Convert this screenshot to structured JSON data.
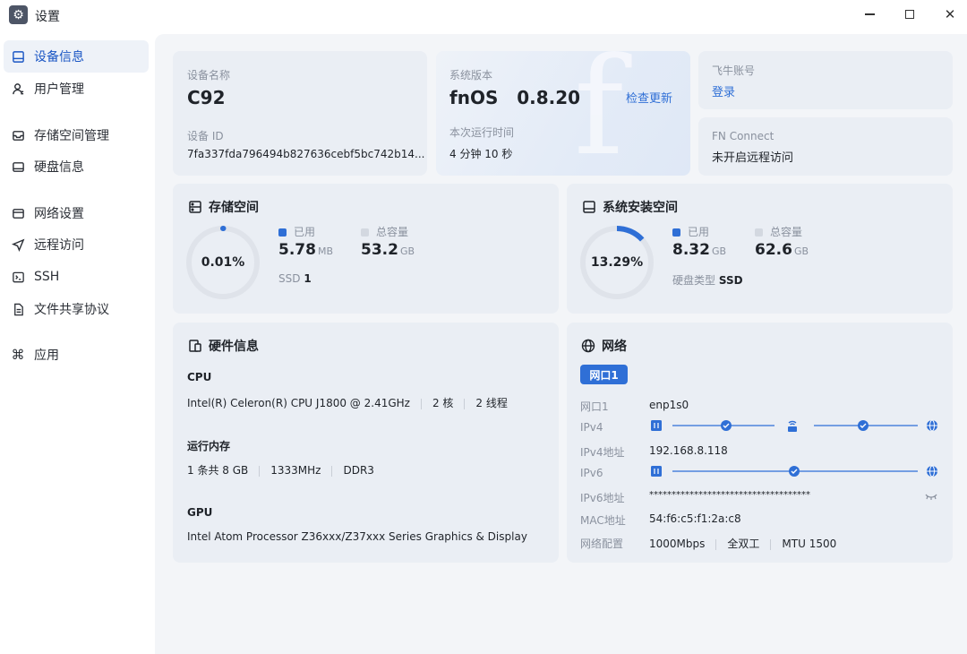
{
  "window": {
    "title": "设置"
  },
  "sidebar": {
    "items": [
      {
        "label": "设备信息",
        "icon": "device-icon"
      },
      {
        "label": "用户管理",
        "icon": "user-icon"
      },
      {
        "label": "存储空间管理",
        "icon": "storage-icon"
      },
      {
        "label": "硬盘信息",
        "icon": "disk-icon"
      },
      {
        "label": "网络设置",
        "icon": "network-icon"
      },
      {
        "label": "远程访问",
        "icon": "send-icon"
      },
      {
        "label": "SSH",
        "icon": "terminal-icon"
      },
      {
        "label": "文件共享协议",
        "icon": "file-icon"
      },
      {
        "label": "应用",
        "icon": "command-icon"
      }
    ]
  },
  "device": {
    "name_label": "设备名称",
    "name": "C92",
    "id_label": "设备 ID",
    "id": "7fa337fda796494b827636cebf5bc742b14..."
  },
  "version": {
    "label": "系统版本",
    "value": "fnOS   0.8.20",
    "check_update": "检查更新",
    "uptime_label": "本次运行时间",
    "uptime": "4 分钟 10 秒"
  },
  "account": {
    "label": "飞牛账号",
    "login": "登录"
  },
  "fnconnect": {
    "label": "FN Connect",
    "status": "未开启远程访问"
  },
  "storage": {
    "title": "存储空间",
    "percent_text": "0.01%",
    "percent": 0.0001,
    "used_label": "已用",
    "used_value": "5.78",
    "used_unit": "MB",
    "total_label": "总容量",
    "total_value": "53.2",
    "total_unit": "GB",
    "disk_prefix": "SSD",
    "disk_count": "1"
  },
  "sysinstall": {
    "title": "系统安装空间",
    "percent_text": "13.29%",
    "percent": 0.1329,
    "used_label": "已用",
    "used_value": "8.32",
    "used_unit": "GB",
    "total_label": "总容量",
    "total_value": "62.6",
    "total_unit": "GB",
    "disk_type_label": "硬盘类型",
    "disk_type": "SSD"
  },
  "hardware": {
    "title": "硬件信息",
    "cpu_label": "CPU",
    "cpu_model": "Intel(R) Celeron(R) CPU J1800 @ 2.41GHz",
    "cpu_cores": "2 核",
    "cpu_threads": "2 线程",
    "mem_label": "运行内存",
    "mem_slots": "1 条共 8 GB",
    "mem_speed": "1333MHz",
    "mem_type": "DDR3",
    "gpu_label": "GPU",
    "gpu_model": "Intel Atom Processor Z36xxx/Z37xxx Series Graphics & Display"
  },
  "network": {
    "title": "网络",
    "port_tab": "网口1",
    "port_label": "网口1",
    "port_value": "enp1s0",
    "ipv4_label": "IPv4",
    "ipv4_addr_label": "IPv4地址",
    "ipv4_addr": "192.168.8.118",
    "ipv6_label": "IPv6",
    "ipv6_addr_label": "IPv6地址",
    "ipv6_addr": "************************************",
    "mac_label": "MAC地址",
    "mac": "54:f6:c5:f1:2a:c8",
    "config_label": "网络配置",
    "speed": "1000Mbps",
    "duplex": "全双工",
    "mtu": "MTU 1500"
  },
  "colors": {
    "accent": "#2f6fd6",
    "ring_track": "#dfe3ea",
    "used_legend": "#2f6fd6",
    "total_legend": "#d3d8e0"
  }
}
